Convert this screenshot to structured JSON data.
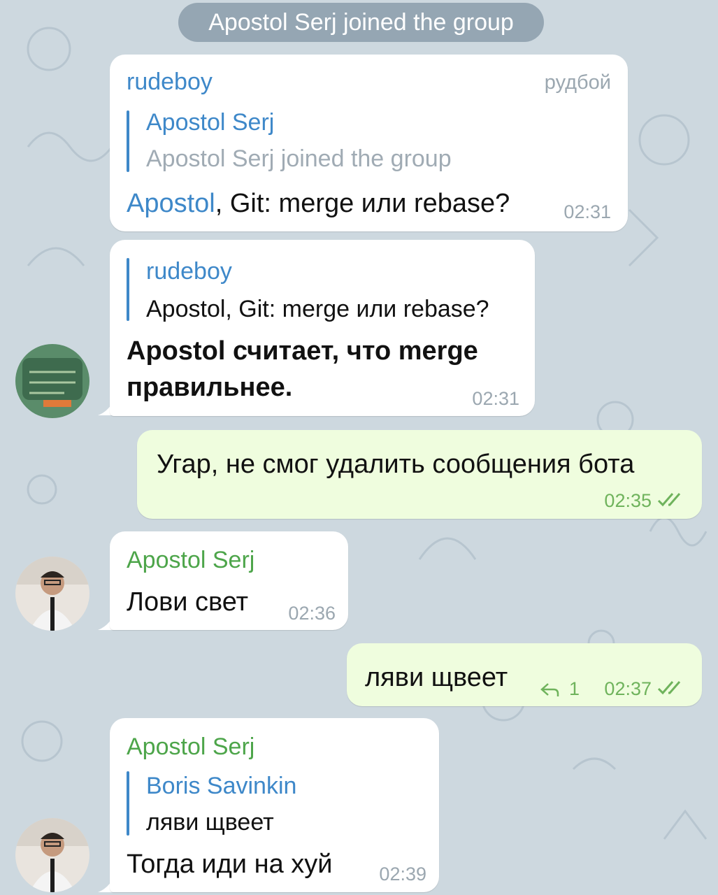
{
  "service_message": "Apostol Serj joined the group",
  "messages": {
    "m1": {
      "sender": "rudeboy",
      "badge": "рудбой",
      "reply_name": "Apostol Serj",
      "reply_text": "Apostol Serj joined the group",
      "mention": "Apostol",
      "text_rest": ", Git: merge или rebase?",
      "time": "02:31"
    },
    "m2": {
      "reply_name": "rudeboy",
      "reply_text": "Apostol, Git: merge или rebase?",
      "text_line1": "Apostol считает, что merge",
      "text_line2": "правильнее.",
      "time": "02:31"
    },
    "m3": {
      "text": "Угар, не смог удалить сообщения бота",
      "time": "02:35"
    },
    "m4": {
      "sender": "Apostol Serj",
      "text": "Лови свет",
      "time": "02:36"
    },
    "m5": {
      "text": "ляви щвеет",
      "reply_count": "1",
      "time": "02:37"
    },
    "m6": {
      "sender": "Apostol Serj",
      "reply_name": "Boris Savinkin",
      "reply_text": "ляви щвеет",
      "text": "Тогда иди на хуй",
      "time": "02:39"
    }
  },
  "colors": {
    "background": "#cdd8df",
    "incoming_bubble": "#ffffff",
    "outgoing_bubble": "#effdde",
    "link_blue": "#3e88c9",
    "sender_green": "#4da54a",
    "sender_blue": "#3e88c9"
  }
}
